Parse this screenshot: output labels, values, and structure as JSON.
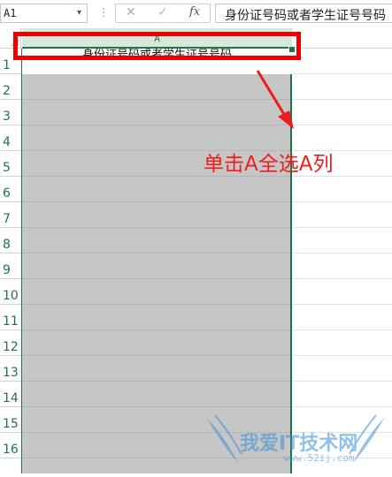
{
  "formula_bar": {
    "name_box": "A1",
    "separator": "⋮",
    "cancel_glyph": "✕",
    "enter_glyph": "✓",
    "fx_label": "fx",
    "content": "身份证号码或者学生证号号码"
  },
  "column_headers": [
    "A"
  ],
  "row_numbers": [
    "1",
    "2",
    "3",
    "4",
    "5",
    "6",
    "7",
    "8",
    "9",
    "10",
    "11",
    "12",
    "13",
    "14",
    "15",
    "16"
  ],
  "cells": {
    "A1": "身份证号码或者学生证号号码"
  },
  "annotation": {
    "text": "单击A全选A列",
    "color": "#ee1d1d"
  },
  "watermark": {
    "text": "我爱IT技术网",
    "url": "www.52ij.com"
  },
  "colors": {
    "excel_green": "#217346",
    "selection_gray": "#c6c6c6",
    "highlight_red": "#ee0000"
  }
}
